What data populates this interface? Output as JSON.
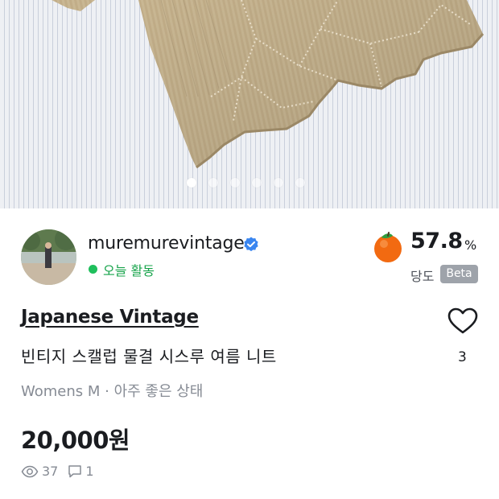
{
  "gallery": {
    "image_count": 6,
    "active_index": 0
  },
  "seller": {
    "name": "muremurevintage",
    "activity": "오늘 활동",
    "temperature": "57.8",
    "temperature_unit": "%",
    "temperature_label": "당도",
    "badge": "Beta",
    "colors": {
      "active": "#1fbf5c",
      "verified": "#3a86f0"
    }
  },
  "product": {
    "brand": "Japanese Vintage",
    "title": "빈티지 스캘럽 물결 시스루 여름 니트",
    "meta": "Womens M · 아주 좋은 상태",
    "price": "20,000원",
    "likes": "3",
    "views": "37",
    "chats": "1"
  }
}
